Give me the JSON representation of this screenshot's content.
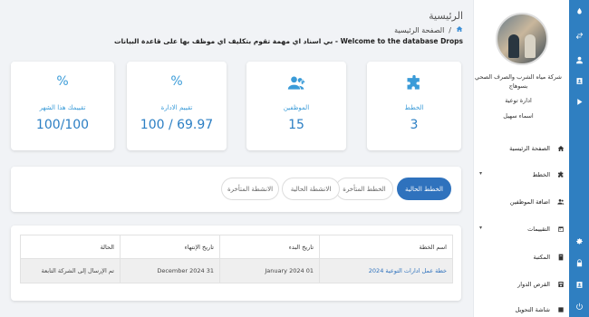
{
  "header": {
    "title": "الرئيسية",
    "breadcrumb": "الصفحة الرئيسية",
    "breadcrumb_sep": "/",
    "welcome": "Welcome to the database Drops - بي اسناد اي مهمة تقوم بتكليف اي موظف بها على قاعدة البيانات"
  },
  "profile": {
    "org": "شركة مياه الشرب والصرف الصحي بسوهاج",
    "dept": "ادارة توعية",
    "name": "اسماء سهيل"
  },
  "sidebar": {
    "items": [
      {
        "label": "الصفحة الرئيسية",
        "icon": "home-icon",
        "caret": ""
      },
      {
        "label": "الخطط",
        "icon": "puzzle-icon",
        "caret": "▾"
      },
      {
        "label": "اضافة الموظفين",
        "icon": "users-icon",
        "caret": ""
      },
      {
        "label": "التقييمات",
        "icon": "calendar-icon",
        "caret": "▾"
      },
      {
        "label": "المكتبة",
        "icon": "book-icon",
        "caret": ""
      },
      {
        "label": "القرص الدوار",
        "icon": "disk-icon",
        "caret": ""
      },
      {
        "label": "شاشة التحويل",
        "icon": "transfer-icon",
        "caret": ""
      }
    ]
  },
  "cards": [
    {
      "label": "الخطط",
      "value": "3",
      "icon": "puzzle-icon"
    },
    {
      "label": "الموظفين",
      "value": "15",
      "icon": "users-icon"
    },
    {
      "label": "تقييم الادارة",
      "value": "100 / 69.97",
      "icon": "percent-icon",
      "glyph": "%"
    },
    {
      "label": "تقييمك هذا الشهر",
      "value": "100/100",
      "icon": "percent-icon",
      "glyph": "%"
    }
  ],
  "tabs": [
    {
      "label": "الخطط الحالية",
      "active": true
    },
    {
      "label": "الخطط المتأخرة",
      "active": false
    },
    {
      "label": "الانشطة الحالية",
      "active": false
    },
    {
      "label": "الانشطة المتأخرة",
      "active": false
    }
  ],
  "table": {
    "headers": [
      "اسم الخطة",
      "تاريخ البدء",
      "تاريخ الإنتهاء",
      "الحالة"
    ],
    "rows": [
      [
        "خطة عمل ادارات التوعية 2024",
        "01 January 2024",
        "31 December 2024",
        "تم الإرسال إلى الشركة التابعة"
      ]
    ]
  },
  "colors": {
    "accent": "#2f72bd",
    "rail": "#2f7fc1",
    "icon": "#3a9bd8"
  }
}
